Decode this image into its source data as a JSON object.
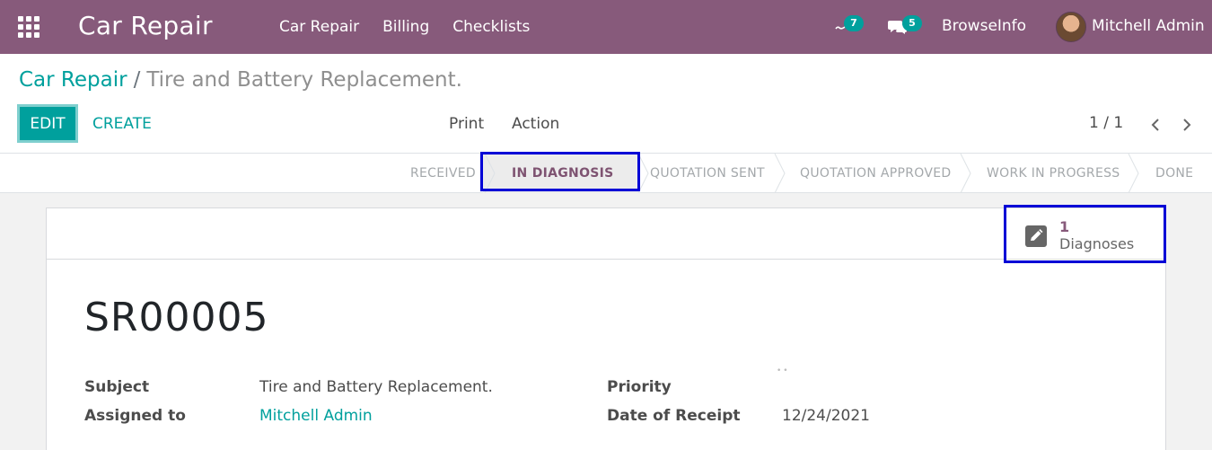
{
  "navbar": {
    "brand": "Car Repair",
    "menu": [
      "Car Repair",
      "Billing",
      "Checklists"
    ],
    "activity_badge": "7",
    "messages_badge": "5",
    "company": "BrowseInfo",
    "user": "Mitchell Admin"
  },
  "breadcrumb": {
    "parent": "Car Repair",
    "separator": "/",
    "current": "Tire and Battery Replacement."
  },
  "buttons": {
    "edit": "EDIT",
    "create": "CREATE",
    "print": "Print",
    "action": "Action"
  },
  "pager": {
    "value": "1 / 1"
  },
  "statusbar": {
    "stages": [
      "RECEIVED",
      "IN DIAGNOSIS",
      "QUOTATION SENT",
      "QUOTATION APPROVED",
      "WORK IN PROGRESS",
      "DONE"
    ],
    "current": "IN DIAGNOSIS"
  },
  "smart_button": {
    "value": "1",
    "label": "Diagnoses",
    "icon": "pencil-icon"
  },
  "record": {
    "name": "SR00005",
    "fields": {
      "subject_label": "Subject",
      "subject_value": "Tire and Battery Replacement.",
      "assigned_label": "Assigned to",
      "assigned_value": "Mitchell Admin",
      "priority_label": "Priority",
      "date_label": "Date of Receipt",
      "date_value": "12/24/2021"
    }
  },
  "colors": {
    "navbar": "#875a7b",
    "accent": "#00a09d",
    "highlight_box": "#0000d6"
  }
}
